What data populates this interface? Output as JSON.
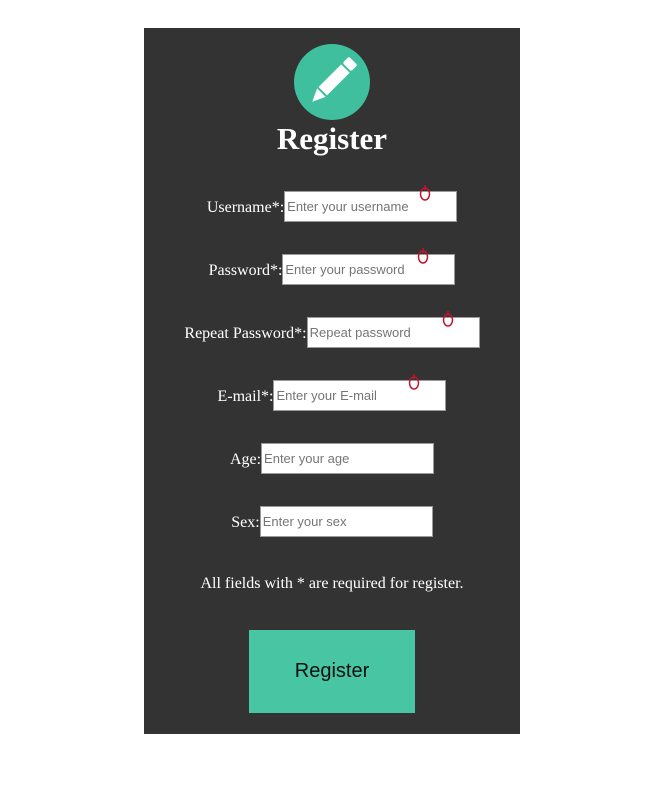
{
  "form": {
    "title": "Register",
    "logo_icon": "pencil-icon",
    "accent_color": "#3fbf9d",
    "panel_color": "#333333",
    "fields": [
      {
        "label": "Username*:",
        "placeholder": "Enter your username",
        "value": "",
        "required": true
      },
      {
        "label": "Password*:",
        "placeholder": "Enter your password",
        "value": "",
        "required": true
      },
      {
        "label": "Repeat Password*:",
        "placeholder": "Repeat password",
        "value": "",
        "required": true
      },
      {
        "label": "E-mail*:",
        "placeholder": "Enter your E-mail",
        "value": "",
        "required": true
      },
      {
        "label": "Age:",
        "placeholder": "Enter your age",
        "value": "",
        "required": false
      },
      {
        "label": "Sex:",
        "placeholder": "Enter your sex",
        "value": "",
        "required": false
      }
    ],
    "required_note": "All fields with * are required for register.",
    "submit_label": "Register"
  }
}
